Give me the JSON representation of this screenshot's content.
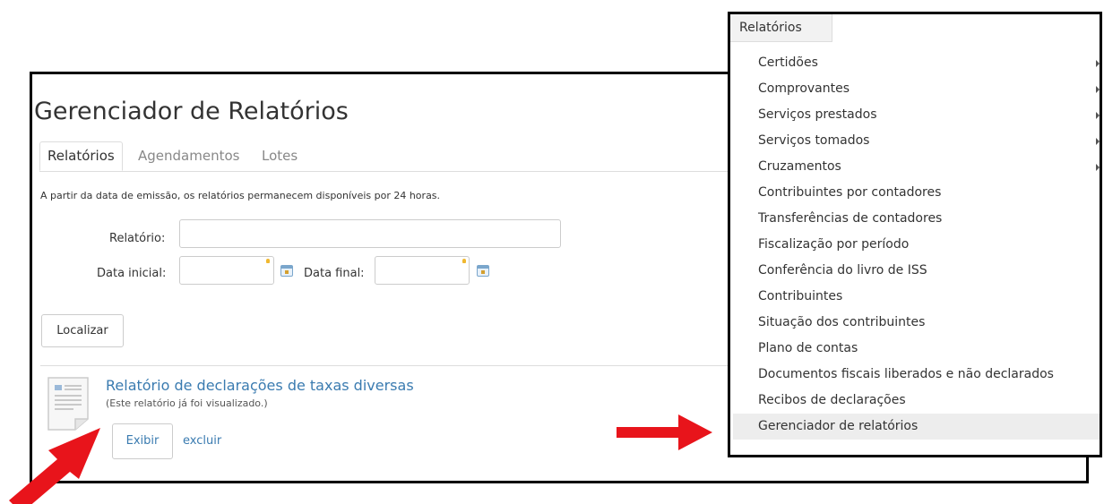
{
  "page": {
    "title": "Gerenciador de Relatórios",
    "tabs": [
      {
        "label": "Relatórios",
        "active": true
      },
      {
        "label": "Agendamentos",
        "active": false
      },
      {
        "label": "Lotes",
        "active": false
      }
    ],
    "info_text": "A partir da data de emissão, os relatórios permanecem disponíveis por 24 horas."
  },
  "form": {
    "relatorio_label": "Relatório:",
    "relatorio_value": "",
    "data_inicial_label": "Data inicial:",
    "data_inicial_value": "",
    "data_final_label": "Data final:",
    "data_final_value": "",
    "search_button": "Localizar"
  },
  "report": {
    "title": "Relatório de declarações de taxas diversas",
    "note": "(Este relatório já foi visualizado.)",
    "view_button": "Exibir",
    "delete_link": "excluir",
    "icon": "document-icon"
  },
  "menu": {
    "header": "Relatórios",
    "items": [
      {
        "label": "Certidões",
        "submenu": true
      },
      {
        "label": "Comprovantes",
        "submenu": true
      },
      {
        "label": "Serviços prestados",
        "submenu": true
      },
      {
        "label": "Serviços tomados",
        "submenu": true
      },
      {
        "label": "Cruzamentos",
        "submenu": true
      },
      {
        "label": "Contribuintes por contadores",
        "submenu": false
      },
      {
        "label": "Transferências de contadores",
        "submenu": false
      },
      {
        "label": "Fiscalização por período",
        "submenu": false
      },
      {
        "label": "Conferência do livro de ISS",
        "submenu": false
      },
      {
        "label": "Contribuintes",
        "submenu": false
      },
      {
        "label": "Situação dos contribuintes",
        "submenu": false
      },
      {
        "label": "Plano de contas",
        "submenu": false
      },
      {
        "label": "Documentos fiscais liberados e não declarados",
        "submenu": false
      },
      {
        "label": "Recibos de declarações",
        "submenu": false
      },
      {
        "label": "Gerenciador de relatórios",
        "submenu": false,
        "highlighted": true
      }
    ]
  },
  "colors": {
    "link": "#3a7bb0",
    "annotation_arrow": "#e8141b",
    "highlight": "#ededed"
  }
}
